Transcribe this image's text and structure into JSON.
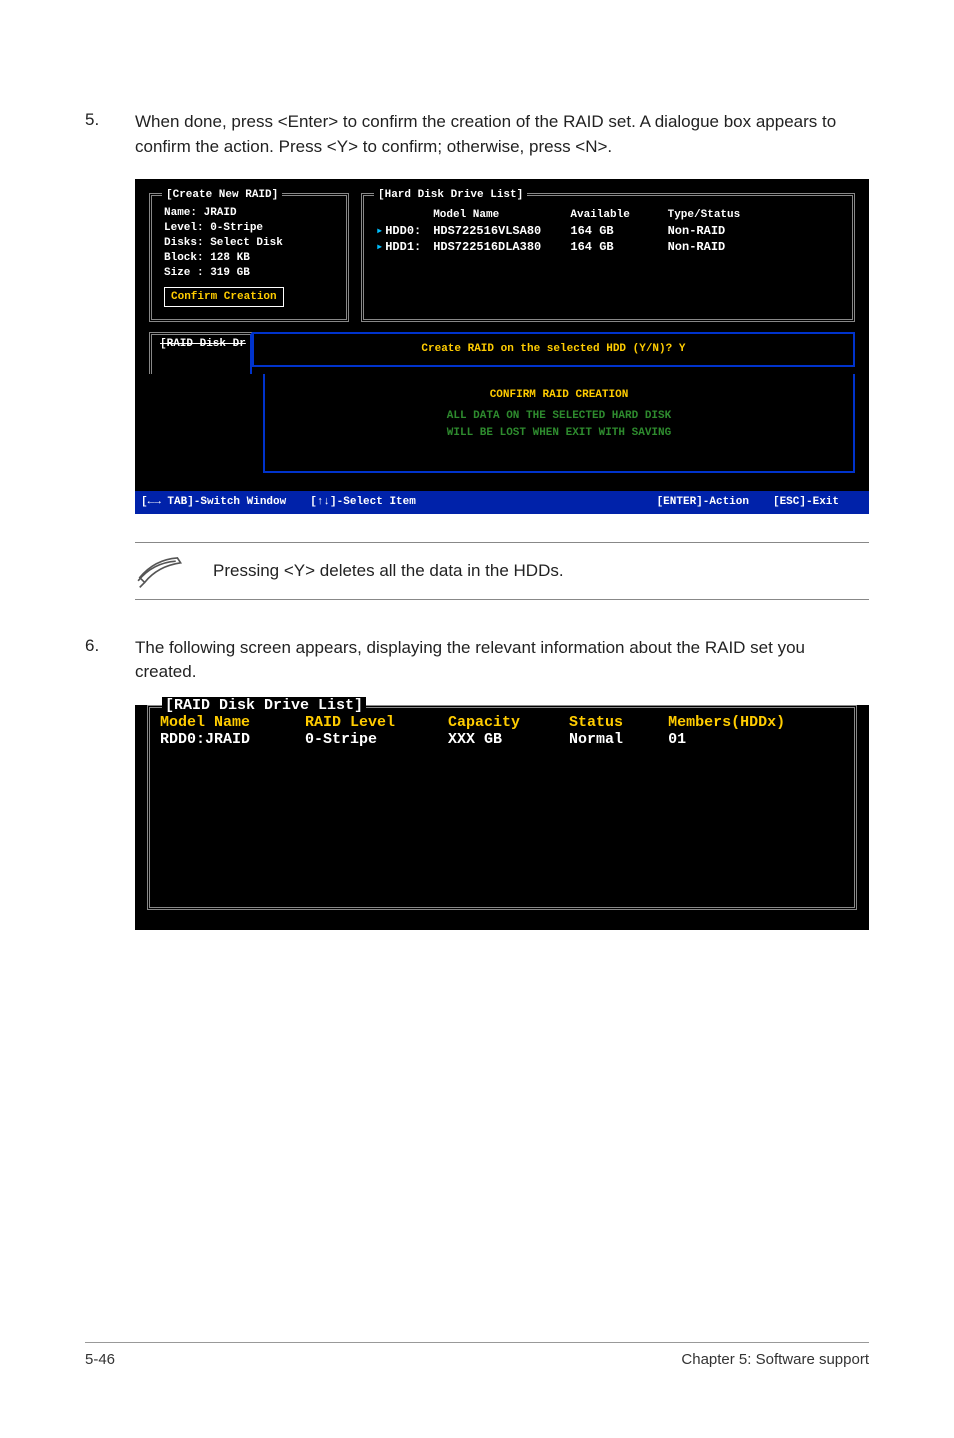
{
  "step5": {
    "num": "5.",
    "text": "When done, press <Enter> to confirm the creation of the RAID set. A dialogue box appears to confirm the action. Press <Y> to confirm; otherwise, press <N>."
  },
  "console1": {
    "create_box_title": "[Create New RAID]",
    "name": "Name: JRAID",
    "level": "Level: 0-Stripe",
    "disks": "Disks: Select Disk",
    "block": "Block: 128 KB",
    "size": "Size : 319 GB",
    "confirm_creation": "Confirm Creation",
    "hdd_box_title": "[Hard Disk Drive List]",
    "hdd_headers": {
      "model": "Model Name",
      "available": "Available",
      "type": "Type/Status"
    },
    "hdd_rows": [
      {
        "id": "HDD0:",
        "model": "HDS722516VLSA80",
        "avail": "164 GB",
        "type": "Non-RAID"
      },
      {
        "id": "HDD1:",
        "model": "HDS722516DLA380",
        "avail": "164 GB",
        "type": "Non-RAID"
      }
    ],
    "raid_dr_title": "[RAID Disk Dr",
    "dialog_prompt": "Create RAID on the selected HDD (Y/N)? Y",
    "warn1": "CONFIRM RAID CREATION",
    "warn2": "ALL DATA ON THE SELECTED HARD DISK",
    "warn3": "WILL BE LOST WHEN EXIT WITH SAVING",
    "footer_tab": "[←→ TAB]-Switch Window",
    "footer_select": "[↑↓]-Select Item",
    "footer_enter": "[ENTER]-Action",
    "footer_esc": "[ESC]-Exit"
  },
  "note": {
    "text": "Pressing <Y> deletes all the data in the HDDs."
  },
  "step6": {
    "num": "6.",
    "text": "The following screen appears, displaying the relevant information about the RAID set you created."
  },
  "console2": {
    "box_title": "[RAID Disk Drive List]",
    "headers": {
      "model": "Model Name",
      "level": "RAID Level",
      "capacity": "Capacity",
      "status": "Status",
      "members": "Members(HDDx)"
    },
    "row": {
      "model": "RDD0:JRAID",
      "level": "0-Stripe",
      "capacity": "XXX GB",
      "status": "Normal",
      "members": "01"
    }
  },
  "page_footer": {
    "left": "5-46",
    "right": "Chapter 5: Software support"
  }
}
